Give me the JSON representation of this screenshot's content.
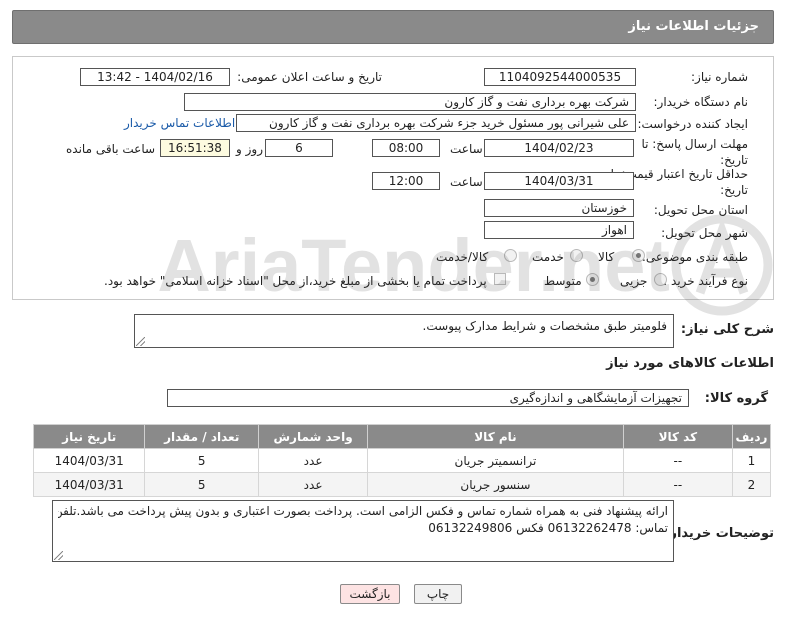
{
  "header": {
    "title": "جزئیات اطلاعات نیاز"
  },
  "form": {
    "need_number_label": "شماره نیاز:",
    "need_number": "1104092544000535",
    "announce_label": "تاریخ و ساعت اعلان عمومی:",
    "announce_value": "1404/02/16 - 13:42",
    "buyer_org_label": "نام دستگاه خریدار:",
    "buyer_org": "شرکت بهره برداری نفت و گاز کارون",
    "creator_label": "ایجاد کننده درخواست:",
    "creator": "علی شیرانی پور مسئول خرید جزء شرکت بهره برداری نفت و گاز کارون",
    "buyer_contact_link": "اطلاعات تماس خریدار",
    "deadline_label": "مهلت ارسال پاسخ: تا تاریخ:",
    "deadline_date": "1404/02/23",
    "time_label": "ساعت",
    "deadline_time": "08:00",
    "days_value": "6",
    "days_label": "روز و",
    "remaining_time": "16:51:38",
    "remaining_label": "ساعت باقی مانده",
    "validity_label": "حداقل تاریخ اعتبار قیمت: تا تاریخ:",
    "validity_date": "1404/03/31",
    "validity_time": "12:00",
    "province_label": "استان محل تحویل:",
    "province": "خوزستان",
    "city_label": "شهر محل تحویل:",
    "city": "اهواز",
    "category_label": "طبقه بندی موضوعی:",
    "category_options": [
      "کالا",
      "خدمت",
      "کالا/خدمت"
    ],
    "process_label": "نوع فرآیند خرید :",
    "process_options": [
      "جزیی",
      "متوسط"
    ],
    "payment_note": "پرداخت تمام یا بخشی از مبلغ خرید،از محل \"اسناد خزانه اسلامی\" خواهد بود."
  },
  "watermark": {
    "text": "AriaTender.net"
  },
  "description": {
    "label": "شرح کلی نیاز:",
    "value": "فلومیتر طبق مشخصات و شرایط مدارک پیوست."
  },
  "goods": {
    "section_title": "اطلاعات کالاهای مورد نیاز",
    "group_label": "گروه کالا:",
    "group_value": "تجهیزات آزمایشگاهی و اندازه‌گیری",
    "columns": [
      "ردیف",
      "کد کالا",
      "نام کالا",
      "واحد شمارش",
      "تعداد / مقدار",
      "تاریخ نیاز"
    ],
    "rows": [
      {
        "idx": "1",
        "code": "--",
        "name": "ترانسمیتر جریان",
        "unit": "عدد",
        "qty": "5",
        "date": "1404/03/31"
      },
      {
        "idx": "2",
        "code": "--",
        "name": "سنسور جریان",
        "unit": "عدد",
        "qty": "5",
        "date": "1404/03/31"
      }
    ]
  },
  "buyer_notes": {
    "label": "توضیحات خریدار:",
    "line1": "ارائه پیشنهاد فنی به همراه شماره تماس و فکس الزامی است. پرداخت بصورت اعتباری و بدون پیش پرداخت می باشد.تلفن",
    "line2": "تماس: 06132262478 فکس 06132249806"
  },
  "buttons": {
    "print": "چاپ",
    "back": "بازگشت"
  },
  "colors": {
    "header_bg": "#8a8a8a",
    "link": "#1a5aa8",
    "back_btn_bg": "#fde3e3",
    "print_btn_bg": "#f1f1f1"
  }
}
